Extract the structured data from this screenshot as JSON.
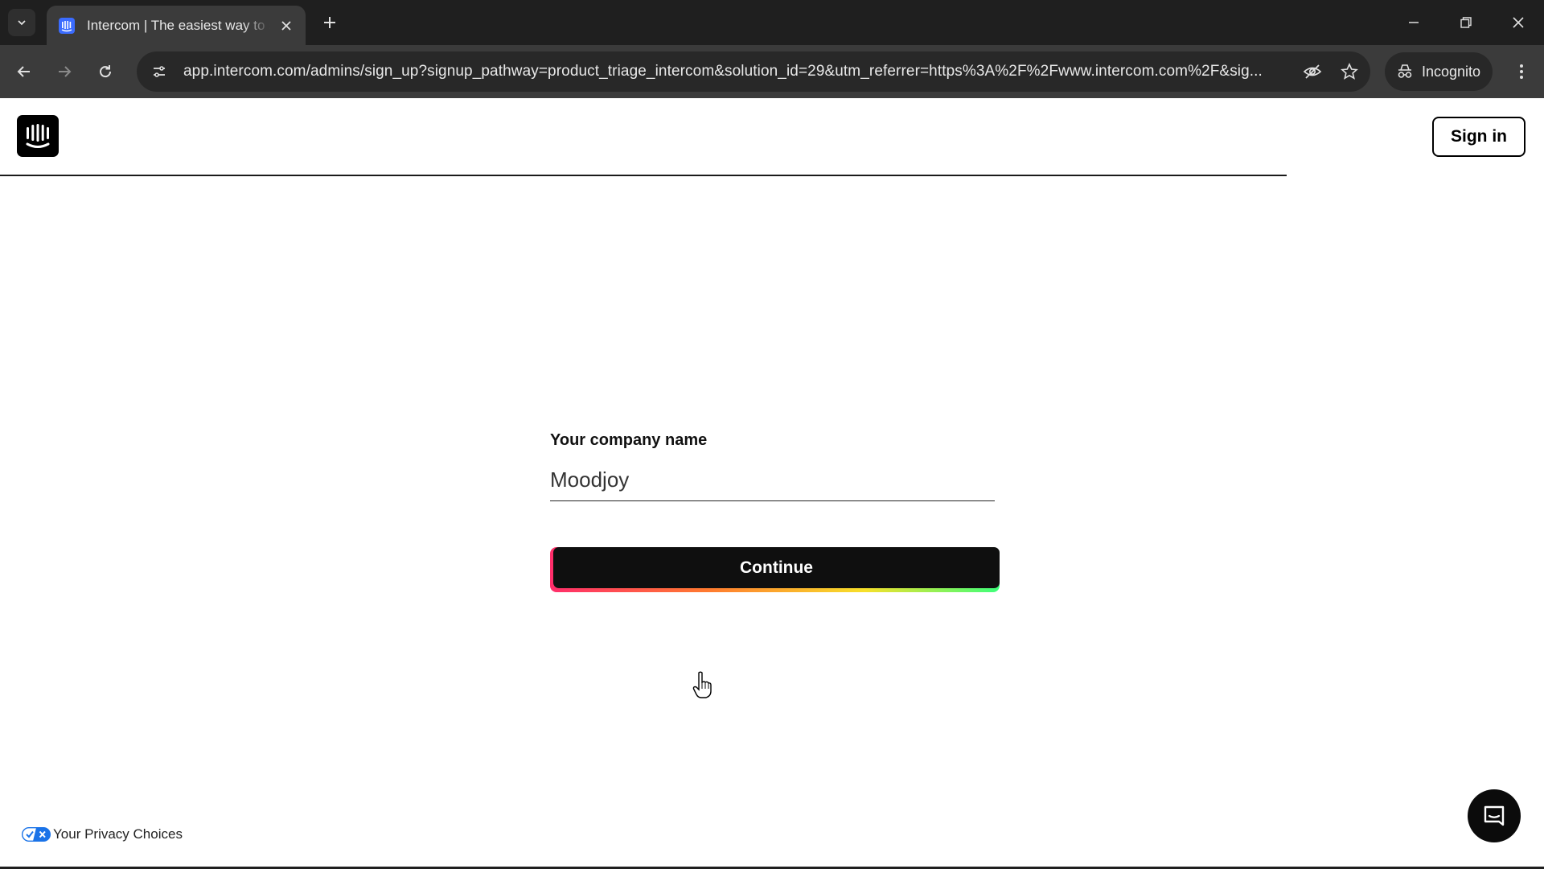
{
  "browser": {
    "tab": {
      "title": "Intercom | The easiest way to s",
      "favicon": "intercom-logo-icon"
    },
    "url": "app.intercom.com/admins/sign_up?signup_pathway=product_triage_intercom&solution_id=29&utm_referrer=https%3A%2F%2Fwww.intercom.com%2F&sig...",
    "incognito_label": "Incognito"
  },
  "page": {
    "header": {
      "logo": "intercom-logo-icon",
      "signin_label": "Sign in"
    },
    "form": {
      "company_label": "Your company name",
      "company_value": "Moodjoy",
      "continue_label": "Continue"
    },
    "footer": {
      "privacy_label": "Your Privacy Choices"
    }
  },
  "colors": {
    "chrome_dark": "#1f1f1f",
    "chrome_toolbar": "#3b3b3b",
    "button_black": "#0f0f0f",
    "gradient": [
      "#ff2d6b",
      "#ff7a2f",
      "#f7e02a",
      "#3cff7a"
    ],
    "privacy_blue": "#1a73e8"
  }
}
